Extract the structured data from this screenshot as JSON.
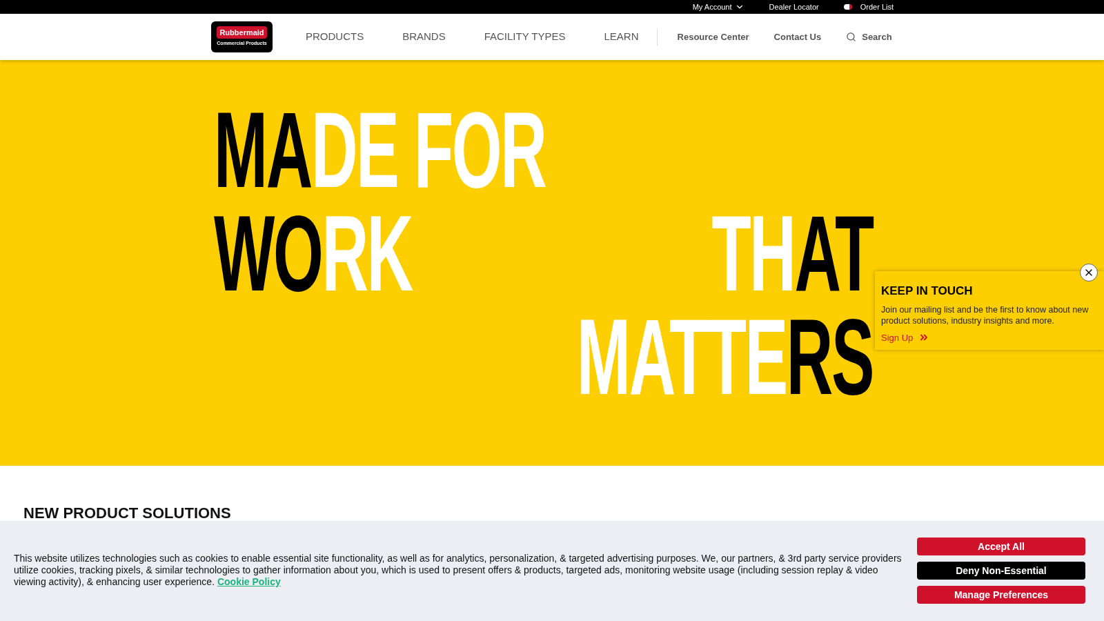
{
  "utility_bar": {
    "links": [
      {
        "label": "My Account",
        "kind": "dropdown"
      },
      {
        "label": "Dealer Locator",
        "kind": "link"
      },
      {
        "label": "Order List",
        "kind": "cart"
      }
    ]
  },
  "logo": {
    "name": "Rubbermaid",
    "tagline": "Commercial Products"
  },
  "nav": {
    "main": [
      "PRODUCTS",
      "BRANDS",
      "FACILITY TYPES",
      "LEARN"
    ],
    "secondary": [
      "Resource Center",
      "Contact Us"
    ],
    "search": "Search"
  },
  "hero": {
    "rows": [
      {
        "left": [
          {
            "text": "MA",
            "dark": true
          },
          {
            "text": "DE FOR",
            "dark": false
          }
        ]
      },
      {
        "left": [
          {
            "text": "WO",
            "dark": true
          },
          {
            "text": "RK",
            "dark": false
          }
        ],
        "right": [
          {
            "text": "TH",
            "dark": false
          },
          {
            "text": "AT",
            "dark": true
          }
        ]
      },
      {
        "right": [
          {
            "text": "MATTE",
            "dark": false
          },
          {
            "text": "RS",
            "dark": true
          }
        ]
      }
    ]
  },
  "popup": {
    "title": "KEEP IN TOUCH",
    "body": "Join our mailing list and be the first to know about new product solutions, industry insights and more.",
    "link": "Sign Up"
  },
  "section": {
    "title": "NEW PRODUCT SOLUTIONS"
  },
  "cookie_banner": {
    "text": "This website utilizes technologies such as cookies to enable essential site functionality, as well as for analytics, personalization, & targeted advertising purposes. We, our partners, & 3rd party service providers utilize cookies, tracking pixels, & similar technologies to gather information about you, which is used to present offers & products, targeted ads, monitoring website usage (including session replay & video viewing activity), & enhancing user experience.",
    "link": "Cookie Policy",
    "buttons": [
      {
        "label": "Accept All",
        "kind": "primary"
      },
      {
        "label": "Deny Non-Essential",
        "kind": "dark"
      },
      {
        "label": "Manage Preferences",
        "kind": "primary"
      }
    ]
  }
}
